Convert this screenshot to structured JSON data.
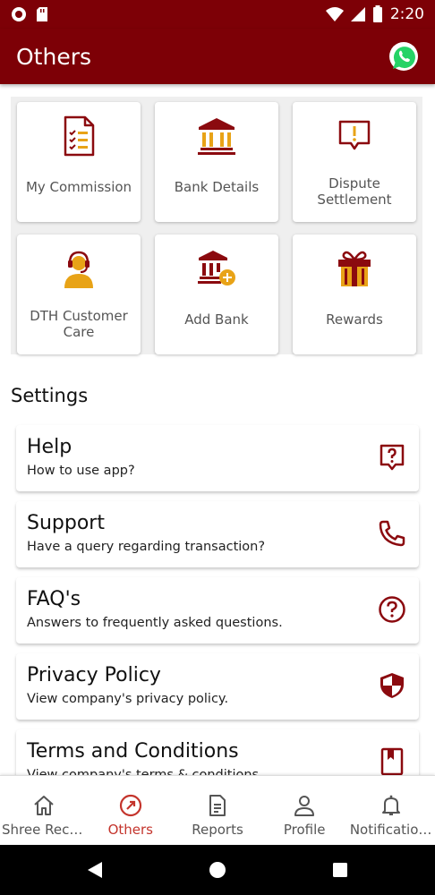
{
  "status_bar": {
    "time": "2:20"
  },
  "app_bar": {
    "title": "Others",
    "action_icon": "whatsapp-icon"
  },
  "colors": {
    "primary": "#7d0006",
    "accent": "#e8a317",
    "active_nav": "#c4342c"
  },
  "tiles": [
    {
      "label": "My Commission",
      "icon": "document-checklist-icon"
    },
    {
      "label": "Bank Details",
      "icon": "bank-icon"
    },
    {
      "label": "Dispute Settlement",
      "icon": "alert-message-icon"
    },
    {
      "label": "DTH Customer Care",
      "icon": "headset-agent-icon"
    },
    {
      "label": "Add Bank",
      "icon": "bank-add-icon"
    },
    {
      "label": "Rewards",
      "icon": "gift-icon"
    }
  ],
  "settings": {
    "title": "Settings",
    "items": [
      {
        "title": "Help",
        "subtitle": "How to use app?",
        "icon": "help-box-icon"
      },
      {
        "title": "Support",
        "subtitle": "Have a query regarding transaction?",
        "icon": "phone-icon"
      },
      {
        "title": "FAQ's",
        "subtitle": "Answers to frequently asked questions.",
        "icon": "question-circle-icon"
      },
      {
        "title": "Privacy Policy",
        "subtitle": "View company's privacy policy.",
        "icon": "shield-icon"
      },
      {
        "title": "Terms and Conditions",
        "subtitle": "View company's terms & conditions.",
        "icon": "bookmark-book-icon"
      }
    ]
  },
  "bottom_nav": [
    {
      "label": "Shree Rech...",
      "icon": "home-icon",
      "active": false
    },
    {
      "label": "Others",
      "icon": "compass-icon",
      "active": true
    },
    {
      "label": "Reports",
      "icon": "report-icon",
      "active": false
    },
    {
      "label": "Profile",
      "icon": "person-icon",
      "active": false
    },
    {
      "label": "Notifications",
      "icon": "bell-icon",
      "active": false
    }
  ]
}
